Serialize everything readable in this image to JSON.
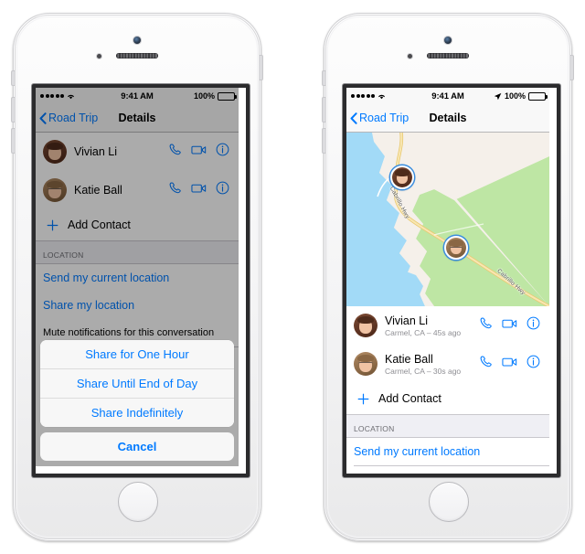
{
  "meta": {
    "accent_blue": "#007aff",
    "sheet_bg": "#f7f7f7",
    "group_bg": "#efeff4"
  },
  "phones": [
    {
      "id": "left",
      "status_bar": {
        "signal_dots": 5,
        "wifi_icon": "wifi-icon",
        "time": "9:41 AM",
        "location_arrow": false,
        "battery_percent": "100%",
        "battery_level": 100
      },
      "nav": {
        "back_icon": "chevron-left-icon",
        "back_label": "Road Trip",
        "title": "Details"
      },
      "has_map": false,
      "contacts": [
        {
          "name": "Vivian Li",
          "subtitle": "",
          "avatar": "a-viv",
          "actions": [
            "phone-icon",
            "video-icon",
            "info-icon"
          ]
        },
        {
          "name": "Katie Ball",
          "subtitle": "",
          "avatar": "a-kat",
          "actions": [
            "phone-icon",
            "video-icon",
            "info-icon"
          ]
        }
      ],
      "add_contact": {
        "icon": "plus-icon",
        "label": "Add Contact"
      },
      "section_location": "LOCATION",
      "location_links": [
        "Send my current location",
        "Share my location"
      ],
      "obscured_row": "Mute notifications for this conversation",
      "action_sheet": {
        "visible": true,
        "options": [
          "Share for One Hour",
          "Share Until End of Day",
          "Share Indefinitely"
        ],
        "cancel": "Cancel"
      }
    },
    {
      "id": "right",
      "status_bar": {
        "signal_dots": 5,
        "wifi_icon": "wifi-icon",
        "time": "9:41 AM",
        "location_arrow": true,
        "battery_percent": "100%",
        "battery_level": 100
      },
      "nav": {
        "back_icon": "chevron-left-icon",
        "back_label": "Road Trip",
        "title": "Details"
      },
      "has_map": true,
      "map": {
        "water_color": "#a2daf7",
        "land_color": "#f5f0ea",
        "park_color": "#bee6a4",
        "road_color": "#f3d88f",
        "road_labels": [
          "Cabrillo Hwy",
          "Cabrillo Hwy"
        ],
        "pins": [
          {
            "avatar": "a-viv",
            "label": "Vivian Li"
          },
          {
            "avatar": "a-kat",
            "label": "Katie Ball"
          }
        ]
      },
      "contacts": [
        {
          "name": "Vivian Li",
          "subtitle": "Carmel, CA – 45s ago",
          "avatar": "a-viv",
          "actions": [
            "phone-icon",
            "video-icon",
            "info-icon"
          ]
        },
        {
          "name": "Katie Ball",
          "subtitle": "Carmel, CA – 30s ago",
          "avatar": "a-kat",
          "actions": [
            "phone-icon",
            "video-icon",
            "info-icon"
          ]
        }
      ],
      "add_contact": {
        "icon": "plus-icon",
        "label": "Add Contact"
      },
      "section_location": "LOCATION",
      "location_links": [
        "Send my current location"
      ],
      "obscured_row": "",
      "action_sheet": {
        "visible": false,
        "options": [],
        "cancel": ""
      }
    }
  ]
}
